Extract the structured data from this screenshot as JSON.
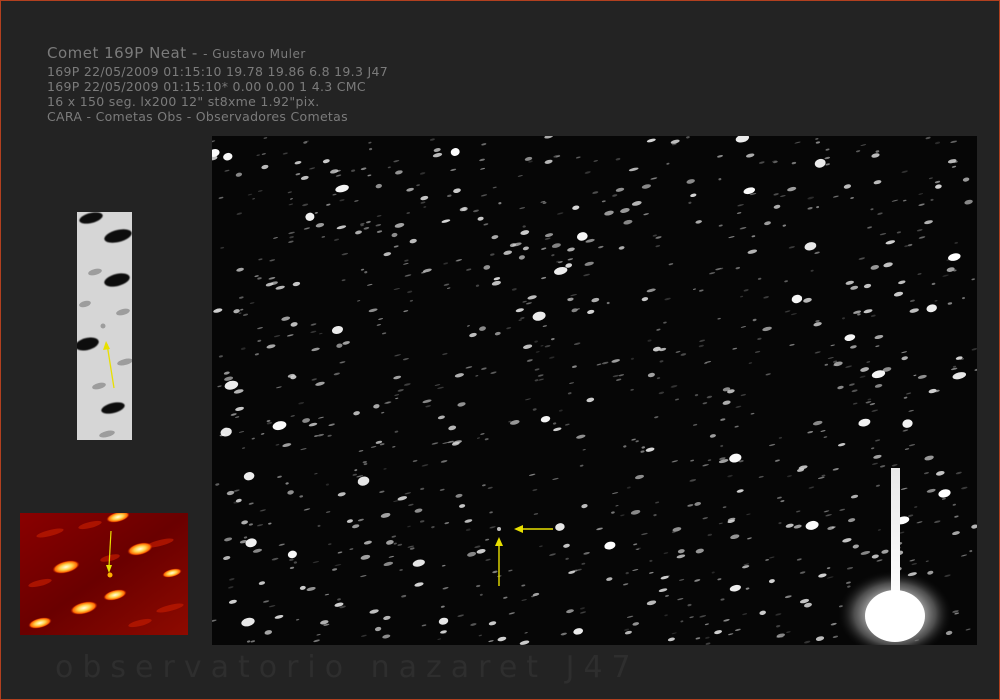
{
  "header": {
    "title": "Comet 169P Neat - ",
    "author": "- Gustavo Muler",
    "line1": "169P 22/05/2009 01:15:10 19.78 19.86 6.8 19.3 J47",
    "line2": "169P 22/05/2009 01:15:10* 0.00 0.00 1 4.3 CMC",
    "line3": "16 x 150 seg. lx200 12\" st8xme 1.92\"pix.",
    "line4": "CARA - Cometas Obs -  Observadores Cometas"
  },
  "footer": {
    "watermark": "observatorio nazaret J47"
  },
  "colors": {
    "frame_border": "#b2401f",
    "background": "#232323",
    "marker_arrow": "#e8e000",
    "header_text": "#7b7b7b"
  }
}
